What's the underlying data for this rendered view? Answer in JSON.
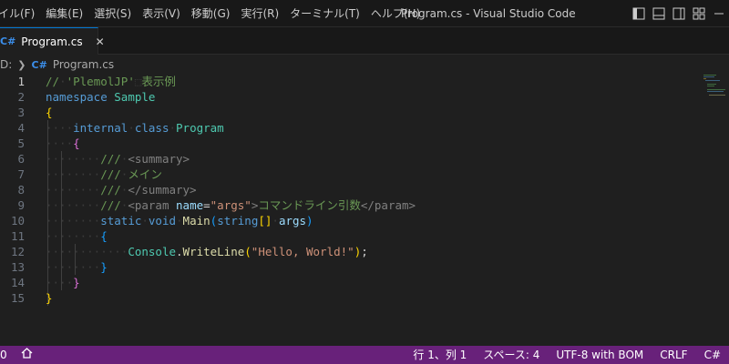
{
  "menu": [
    "イル(F)",
    "編集(E)",
    "選択(S)",
    "表示(V)",
    "移動(G)",
    "実行(R)",
    "ターミナル(T)",
    "ヘルプ(H)"
  ],
  "window_title": "Program.cs - Visual Studio Code",
  "tab": {
    "icon": "C#",
    "label": "Program.cs",
    "close": "✕"
  },
  "breadcrumb": {
    "drive": "D:",
    "icon": "C#",
    "file": "Program.cs"
  },
  "editor": {
    "line_numbers": [
      "1",
      "2",
      "3",
      "4",
      "5",
      "6",
      "7",
      "8",
      "9",
      "10",
      "11",
      "12",
      "13",
      "14",
      "15"
    ],
    "lines": [
      [
        {
          "t": "//",
          "c": "c-comment"
        },
        {
          "t": "·",
          "c": "ws"
        },
        {
          "t": "'PlemolJP'",
          "c": "c-comment"
        },
        {
          "t": "⬚",
          "c": "ws"
        },
        {
          "t": "表示例",
          "c": "c-comment"
        }
      ],
      [
        {
          "t": "namespace",
          "c": "c-kw"
        },
        {
          "t": " ",
          "c": "c-plain"
        },
        {
          "t": "Sample",
          "c": "c-ns"
        }
      ],
      [
        {
          "t": "{",
          "c": "b1"
        }
      ],
      [
        {
          "t": "····",
          "c": "ws"
        },
        {
          "t": "internal",
          "c": "c-kw"
        },
        {
          "t": "·",
          "c": "ws"
        },
        {
          "t": "class",
          "c": "c-kw"
        },
        {
          "t": "·",
          "c": "ws"
        },
        {
          "t": "Program",
          "c": "c-type"
        }
      ],
      [
        {
          "t": "····",
          "c": "ws"
        },
        {
          "t": "{",
          "c": "b2"
        }
      ],
      [
        {
          "t": "········",
          "c": "ws"
        },
        {
          "t": "///",
          "c": "c-doc"
        },
        {
          "t": "·",
          "c": "ws"
        },
        {
          "t": "<summary>",
          "c": "c-tag"
        }
      ],
      [
        {
          "t": "········",
          "c": "ws"
        },
        {
          "t": "///",
          "c": "c-doc"
        },
        {
          "t": "·",
          "c": "ws"
        },
        {
          "t": "メイン",
          "c": "c-doc"
        }
      ],
      [
        {
          "t": "········",
          "c": "ws"
        },
        {
          "t": "///",
          "c": "c-doc"
        },
        {
          "t": "·",
          "c": "ws"
        },
        {
          "t": "</summary>",
          "c": "c-tag"
        }
      ],
      [
        {
          "t": "········",
          "c": "ws"
        },
        {
          "t": "///",
          "c": "c-doc"
        },
        {
          "t": "·",
          "c": "ws"
        },
        {
          "t": "<param",
          "c": "c-tag"
        },
        {
          "t": " ",
          "c": "c-plain"
        },
        {
          "t": "name",
          "c": "c-var"
        },
        {
          "t": "=",
          "c": "c-plain"
        },
        {
          "t": "\"args\"",
          "c": "c-str"
        },
        {
          "t": ">",
          "c": "c-tag"
        },
        {
          "t": "コマンドライン引数",
          "c": "c-doc"
        },
        {
          "t": "</param>",
          "c": "c-tag"
        }
      ],
      [
        {
          "t": "········",
          "c": "ws"
        },
        {
          "t": "static",
          "c": "c-kw"
        },
        {
          "t": "·",
          "c": "ws"
        },
        {
          "t": "void",
          "c": "c-kw"
        },
        {
          "t": "·",
          "c": "ws"
        },
        {
          "t": "Main",
          "c": "c-fn"
        },
        {
          "t": "(",
          "c": "b3"
        },
        {
          "t": "string",
          "c": "c-kw"
        },
        {
          "t": "[]",
          "c": "b1"
        },
        {
          "t": "·",
          "c": "ws"
        },
        {
          "t": "args",
          "c": "c-var"
        },
        {
          "t": ")",
          "c": "b3"
        }
      ],
      [
        {
          "t": "········",
          "c": "ws"
        },
        {
          "t": "{",
          "c": "b3"
        }
      ],
      [
        {
          "t": "············",
          "c": "ws"
        },
        {
          "t": "Console",
          "c": "c-type"
        },
        {
          "t": ".",
          "c": "c-plain"
        },
        {
          "t": "WriteLine",
          "c": "c-fn"
        },
        {
          "t": "(",
          "c": "b1"
        },
        {
          "t": "\"Hello, World!\"",
          "c": "c-str"
        },
        {
          "t": ")",
          "c": "b1"
        },
        {
          "t": ";",
          "c": "c-plain"
        }
      ],
      [
        {
          "t": "········",
          "c": "ws"
        },
        {
          "t": "}",
          "c": "b3"
        }
      ],
      [
        {
          "t": "····",
          "c": "ws"
        },
        {
          "t": "}",
          "c": "b2"
        }
      ],
      [
        {
          "t": "}",
          "c": "b1"
        }
      ]
    ]
  },
  "status": {
    "left_text": "0",
    "position": "行 1、列 1",
    "spaces": "スペース: 4",
    "encoding": "UTF-8 with BOM",
    "eol": "CRLF",
    "language": "C#"
  },
  "colors": {
    "status_bar": "#68217a",
    "accent": "#0078d4"
  }
}
